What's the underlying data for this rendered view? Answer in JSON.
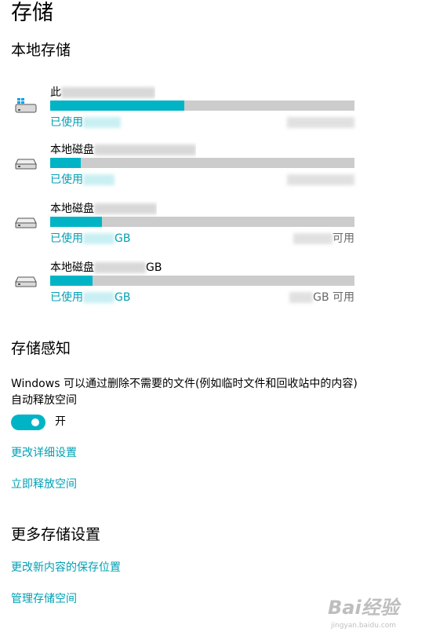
{
  "page_title": "存储",
  "local_storage": {
    "title": "本地存储",
    "drives": [
      {
        "icon": "windows-drive-icon",
        "name": "此",
        "used_label": "已使用",
        "free_label": "",
        "used_fraction": 0.44
      },
      {
        "icon": "disk-drive-icon",
        "name": "本地磁盘",
        "used_label": "已使用",
        "free_label": "",
        "used_fraction": 0.1
      },
      {
        "icon": "disk-drive-icon",
        "name": "本地磁盘",
        "used_label": "已使用",
        "used_unit": "GB",
        "free_label": "可用",
        "used_fraction": 0.17
      },
      {
        "icon": "disk-drive-icon",
        "name": "本地磁盘",
        "name_suffix": "GB",
        "used_label": "已使用",
        "used_unit": "GB",
        "free_label": "GB 可用",
        "used_fraction": 0.14
      }
    ]
  },
  "storage_sense": {
    "title": "存储感知",
    "description": "Windows 可以通过删除不需要的文件(例如临时文件和回收站中的内容)自动释放空间",
    "toggle_label": "开",
    "toggle_on": true,
    "link_change_settings": "更改详细设置",
    "link_free_space": "立即释放空间"
  },
  "more_settings": {
    "title": "更多存储设置",
    "link_save_location": "更改新内容的保存位置",
    "link_manage_spaces": "管理存储空间"
  },
  "watermark": {
    "logo": "Bai经验",
    "url": "jingyan.baidu.com"
  },
  "colors": {
    "accent": "#00b4c6",
    "link": "#00a0b4",
    "bar_bg": "#cccccc"
  }
}
